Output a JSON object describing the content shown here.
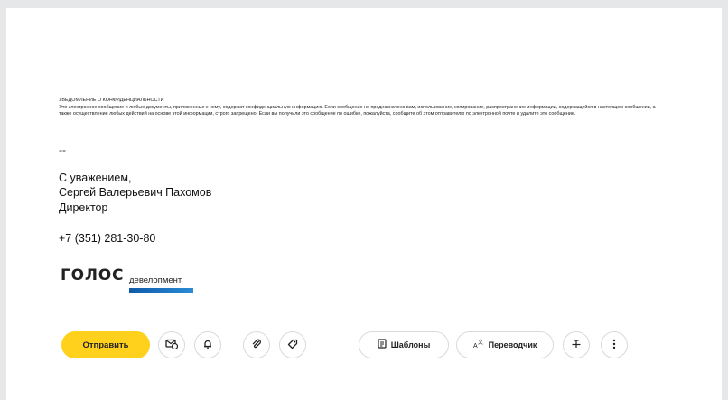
{
  "notice": {
    "title": "УВЕДОМЛЕНИЕ О КОНФИДЕНЦИАЛЬНОСТИ",
    "body": "Это электронное сообщение и любые документы, приложенные к нему, содержат конфиденциальную информацию. Если сообщение не предназначено вам, использование, копирование, распространение информации, содержащейся в настоящем сообщении, а также осуществление любых действий на основе этой информации, строго запрещено. Если вы получили это сообщение по ошибке, пожалуйста, сообщите об этом отправителю по электронной почте и удалите это сообщение."
  },
  "signature": {
    "separator": "--",
    "greeting": "С уважением,",
    "name": "Сергей Валерьевич Пахомов",
    "position": "Директор",
    "phone": "+7 (351) 281-30-80"
  },
  "logo": {
    "word1": "ГОЛОС",
    "word2": "девелопмент",
    "accent": "#1a70bf"
  },
  "toolbar": {
    "send_label": "Отправить",
    "templates_label": "Шаблоны",
    "translator_label": "Переводчик",
    "icons": [
      "mail-schedule-icon",
      "bell-icon",
      "paperclip-icon",
      "tag-icon",
      "template-icon",
      "translate-icon",
      "strikethrough-icon",
      "more-icon"
    ],
    "accent": "#ffd11c"
  }
}
